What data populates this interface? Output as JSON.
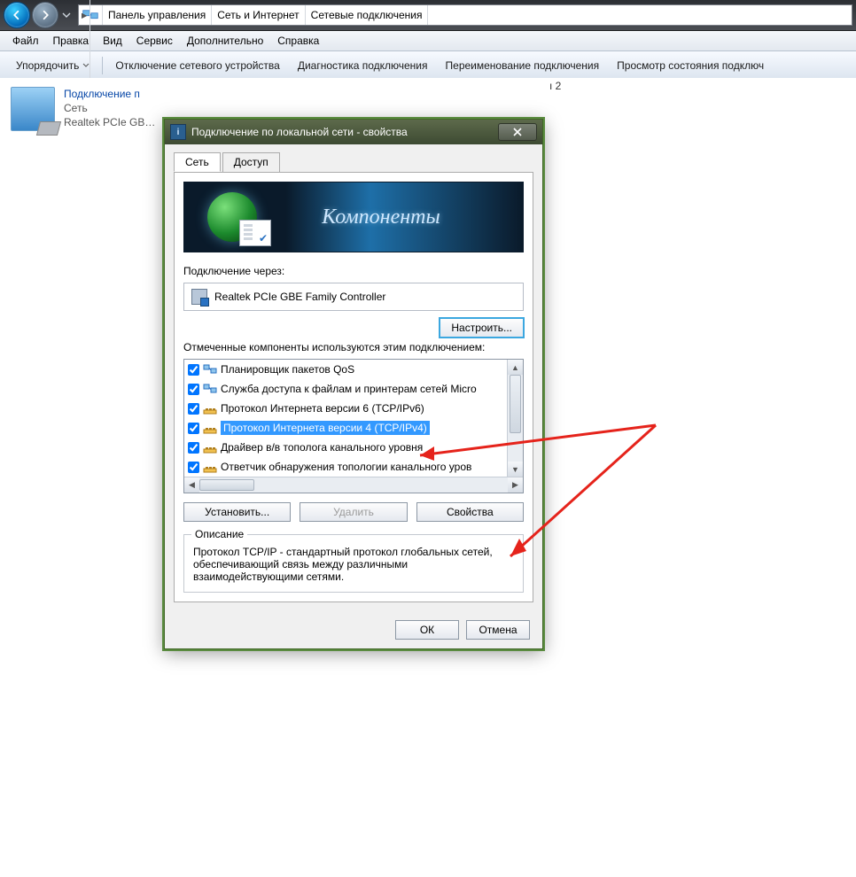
{
  "breadcrumb": {
    "items": [
      "Панель управления",
      "Сеть и Интернет",
      "Сетевые подключения"
    ]
  },
  "menu": {
    "file": "Файл",
    "edit": "Правка",
    "view": "Вид",
    "tools": "Сервис",
    "advanced": "Дополнительно",
    "help": "Справка"
  },
  "cmd": {
    "organize": "Упорядочить",
    "disable": "Отключение сетевого устройства",
    "diagnose": "Диагностика подключения",
    "rename": "Переименование подключения",
    "status": "Просмотр состояния подключ"
  },
  "connItem": {
    "name": "Подключение п",
    "network": "Сеть",
    "device": "Realtek PCIe GB…"
  },
  "backText": "ı 2",
  "dialog": {
    "title": "Подключение по локальной сети - свойства",
    "tabs": {
      "net": "Сеть",
      "access": "Доступ"
    },
    "bannerTitle": "Компоненты",
    "connectThrough": "Подключение через:",
    "adapter": "Realtek PCIe GBE Family Controller",
    "configure": "Настроить...",
    "componentsLabel": "Отмеченные компоненты используются этим подключением:",
    "components": [
      {
        "checked": true,
        "icon": "svc",
        "label": "Планировщик пакетов QoS",
        "selected": false
      },
      {
        "checked": true,
        "icon": "svc",
        "label": "Служба доступа к файлам и принтерам сетей Micro",
        "selected": false
      },
      {
        "checked": true,
        "icon": "proto",
        "label": "Протокол Интернета версии 6 (TCP/IPv6)",
        "selected": false
      },
      {
        "checked": true,
        "icon": "proto",
        "label": "Протокол Интернета версии 4 (TCP/IPv4)",
        "selected": true
      },
      {
        "checked": true,
        "icon": "proto",
        "label": "Драйвер в/в тополога канального уровня",
        "selected": false
      },
      {
        "checked": true,
        "icon": "proto",
        "label": "Ответчик обнаружения топологии канального уров",
        "selected": false
      }
    ],
    "install": "Установить...",
    "uninstall": "Удалить",
    "properties": "Свойства",
    "descLegend": "Описание",
    "descText": "Протокол TCP/IP - стандартный протокол глобальных сетей, обеспечивающий связь между различными взаимодействующими сетями.",
    "ok": "ОК",
    "cancel": "Отмена"
  }
}
